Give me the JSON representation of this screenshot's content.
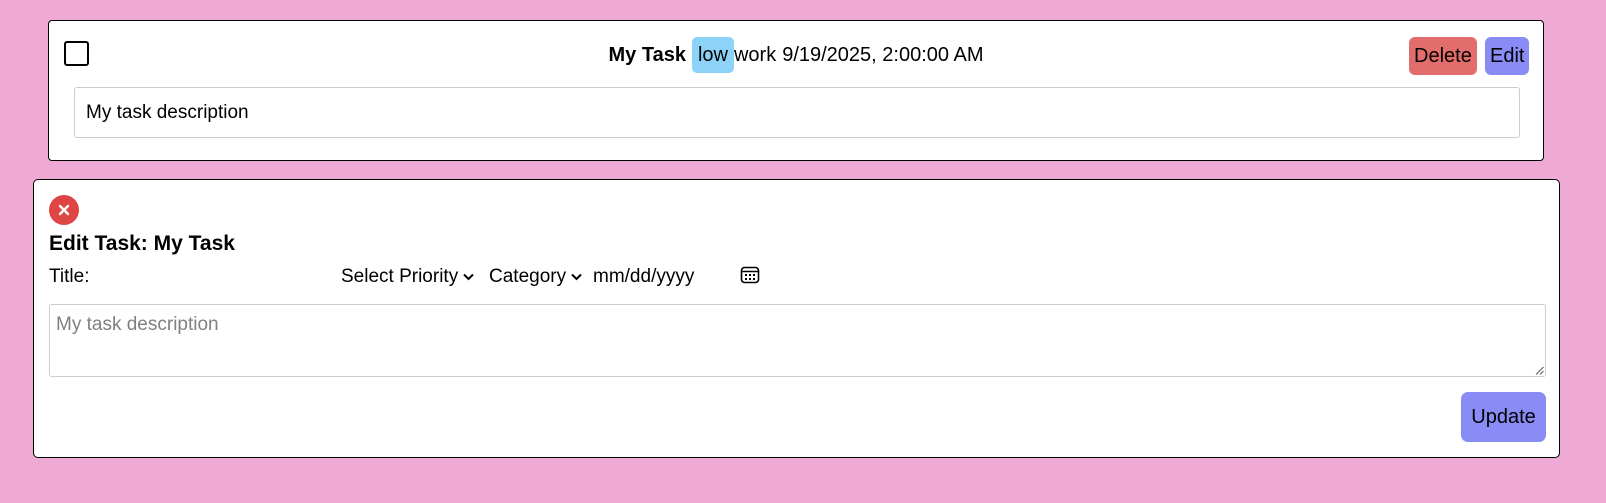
{
  "colors": {
    "page_background": "#eeaad4",
    "priority_badge": "#8dd3f7",
    "delete_button": "#e36c6c",
    "edit_button": "#8a8cf6",
    "update_button": "#8a8cf6",
    "close_button": "#e04545"
  },
  "task": {
    "checked": false,
    "title": "My Task",
    "priority": "low",
    "category": "work",
    "due": "9/19/2025, 2:00:00 AM",
    "delete_label": "Delete",
    "edit_label": "Edit",
    "description": "My task description",
    "checkbox_icon": "checkbox-icon"
  },
  "edit_form": {
    "close_icon": "close-icon",
    "heading_prefix": "Edit Task: ",
    "heading_name": "My Task",
    "title_label": "Title:",
    "title_value": "",
    "priority_placeholder": "Select Priority",
    "category_placeholder": "Category",
    "date_placeholder": "mm/dd/yyyy",
    "calendar_icon": "calendar-icon",
    "description_placeholder": "My task description",
    "update_label": "Update"
  }
}
